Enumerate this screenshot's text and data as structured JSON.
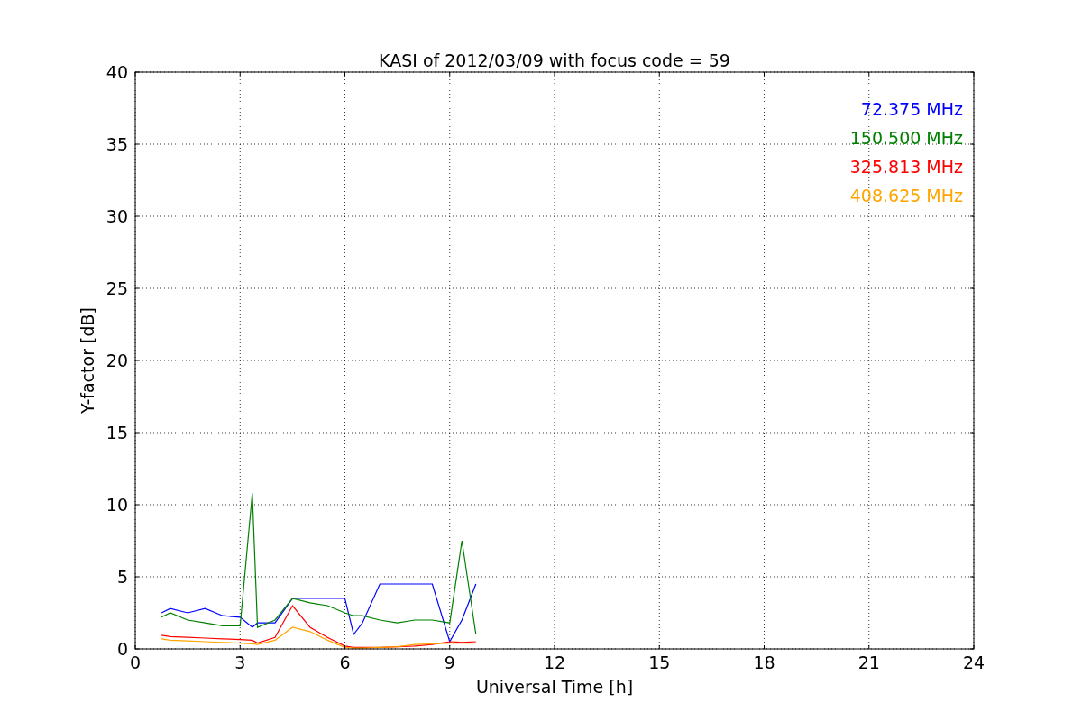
{
  "chart_data": {
    "type": "line",
    "title": "KASI of 2012/03/09 with focus code = 59",
    "xlabel": "Universal Time [h]",
    "ylabel": "Y-factor [dB]",
    "x": [
      0.75,
      1,
      1.5,
      2,
      2.5,
      3,
      3.35,
      3.5,
      4,
      4.5,
      5,
      5.5,
      6,
      6.25,
      6.5,
      7,
      7.5,
      8,
      8.5,
      9,
      9.35,
      9.75
    ],
    "series": [
      {
        "name": "72.375 MHz",
        "color": "#0000ff",
        "values": [
          2.5,
          2.8,
          2.5,
          2.8,
          2.3,
          2.2,
          1.5,
          1.8,
          1.8,
          3.5,
          3.5,
          3.5,
          3.5,
          1.0,
          1.8,
          4.5,
          4.5,
          4.5,
          4.5,
          0.5,
          2.0,
          4.5
        ]
      },
      {
        "name": "150.500 MHz",
        "color": "#008000",
        "values": [
          2.2,
          2.5,
          2.0,
          1.8,
          1.6,
          1.6,
          10.8,
          1.5,
          2.0,
          3.5,
          3.2,
          3.0,
          2.5,
          2.3,
          2.3,
          2.0,
          1.8,
          2.0,
          2.0,
          1.8,
          7.5,
          1.0
        ]
      },
      {
        "name": "325.813 MHz",
        "color": "#ff0000",
        "values": [
          0.95,
          0.85,
          0.8,
          0.75,
          0.7,
          0.65,
          0.6,
          0.4,
          0.8,
          3.0,
          1.5,
          0.8,
          0.2,
          0.1,
          0.1,
          0.1,
          0.15,
          0.2,
          0.3,
          0.5,
          0.45,
          0.5
        ]
      },
      {
        "name": "408.625 MHz",
        "color": "#ffa500",
        "values": [
          0.7,
          0.6,
          0.55,
          0.5,
          0.45,
          0.4,
          0.35,
          0.3,
          0.6,
          1.5,
          1.2,
          0.6,
          0.1,
          0.05,
          0.05,
          0.1,
          0.15,
          0.3,
          0.35,
          0.4,
          0.4,
          0.4
        ]
      }
    ],
    "grid": true,
    "xlim": [
      0,
      24
    ],
    "ylim": [
      0,
      40
    ],
    "xticks": [
      0,
      3,
      6,
      9,
      12,
      15,
      18,
      21,
      24
    ],
    "yticks": [
      0,
      5,
      10,
      15,
      20,
      25,
      30,
      35,
      40
    ]
  }
}
